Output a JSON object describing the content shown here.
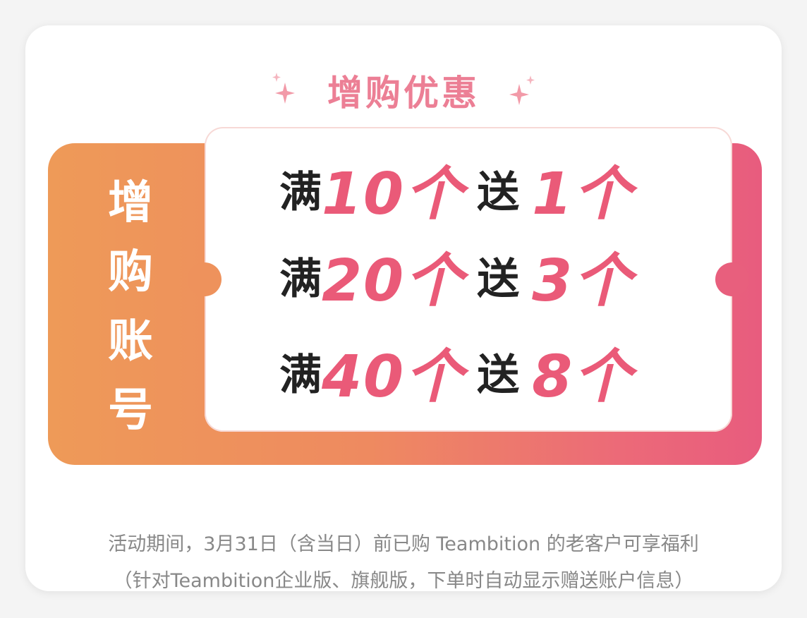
{
  "title": "增购优惠",
  "side_label": [
    "增",
    "购",
    "账",
    "号"
  ],
  "tiers": [
    {
      "prefix": "满",
      "buy": "10个",
      "mid": "送",
      "get": "1个"
    },
    {
      "prefix": "满",
      "buy": "20个",
      "mid": "送",
      "get": "3个"
    },
    {
      "prefix": "满",
      "buy": "40个",
      "mid": "送",
      "get": "8个"
    }
  ],
  "notes": [
    "活动期间，3月31日（含当日）前已购 Teambition 的老客户可享福利",
    "（针对Teambition企业版、旗舰版，下单时自动显示赠送账户信息）"
  ],
  "colors": {
    "accent": "#ea5a78",
    "title": "#ec7f95",
    "banner_start": "#ee9a58",
    "banner_end": "#e85c7e"
  },
  "icons": [
    "sparkle-icon"
  ]
}
